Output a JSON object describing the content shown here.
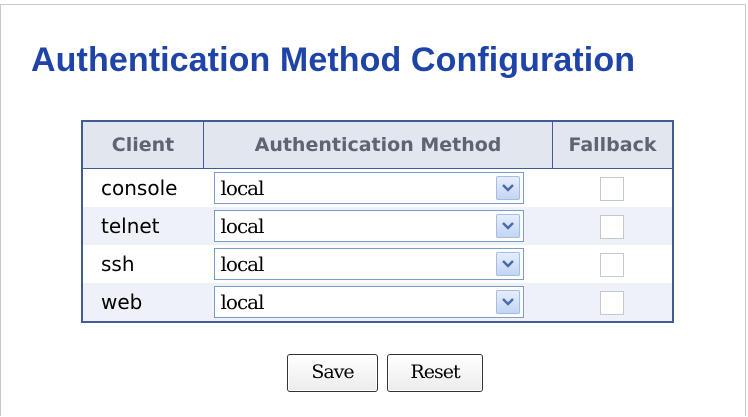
{
  "page": {
    "title": "Authentication Method Configuration"
  },
  "table": {
    "headers": {
      "client": "Client",
      "method": "Authentication Method",
      "fallback": "Fallback"
    },
    "rows": [
      {
        "client": "console",
        "method": "local",
        "fallback": false
      },
      {
        "client": "telnet",
        "method": "local",
        "fallback": false
      },
      {
        "client": "ssh",
        "method": "local",
        "fallback": false
      },
      {
        "client": "web",
        "method": "local",
        "fallback": false
      }
    ]
  },
  "buttons": {
    "save": "Save",
    "reset": "Reset"
  },
  "colors": {
    "title": "#1f44a8",
    "table_border": "#3f5c94",
    "header_bg": "#e1e6ef",
    "alt_row_bg": "#eef1f7"
  },
  "icons": {
    "dropdown": "chevron-down-icon"
  }
}
